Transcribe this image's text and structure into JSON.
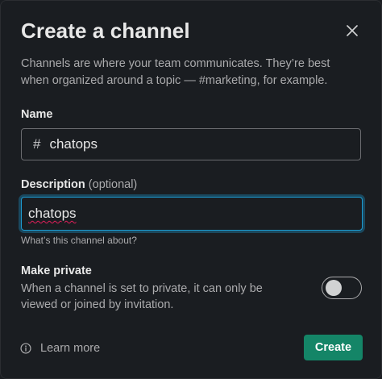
{
  "dialog": {
    "title": "Create a channel",
    "intro": "Channels are where your team communicates. They’re best when organized around a topic — #marketing, for example."
  },
  "name_field": {
    "label": "Name",
    "prefix": "#",
    "value": "chatops"
  },
  "description_field": {
    "label": "Description",
    "optional": "(optional)",
    "value": "chatops",
    "hint": "What’s this channel about?"
  },
  "make_private": {
    "label": "Make private",
    "description": "When a channel is set to private, it can only be viewed or joined by invitation.",
    "enabled": false
  },
  "footer": {
    "learn_more": "Learn more",
    "create_label": "Create"
  },
  "colors": {
    "background": "#1a1d21",
    "accent_blue": "#1d9bd1",
    "create_green": "#148567"
  },
  "icons": {
    "close": "close-icon",
    "info": "info-icon"
  }
}
